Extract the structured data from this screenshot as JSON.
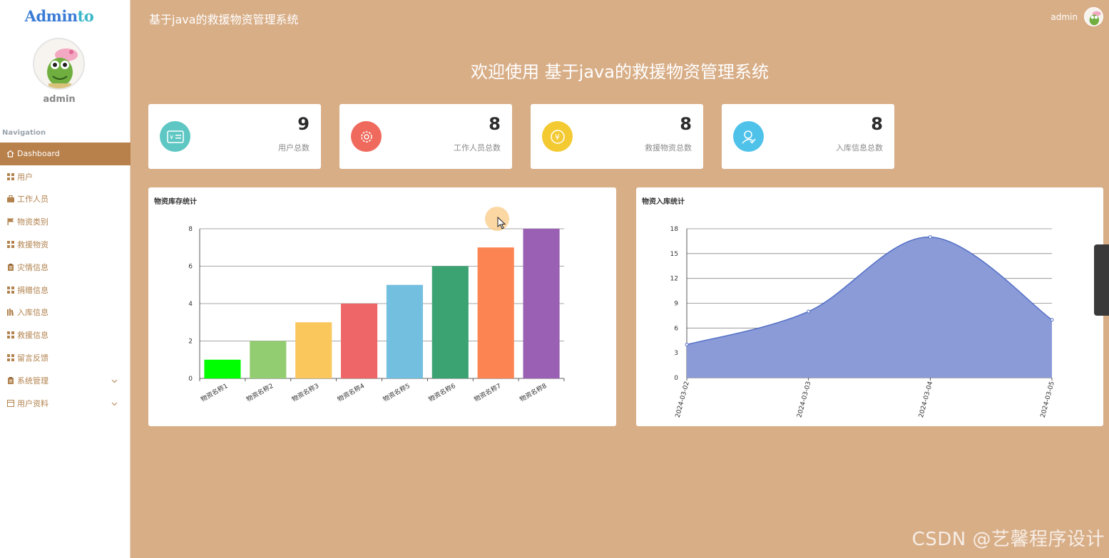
{
  "brand": {
    "logo_part1": "Admin",
    "logo_part2": "to"
  },
  "sidebar": {
    "username": "admin",
    "nav_heading": "Navigation",
    "items": [
      {
        "label": "Dashboard",
        "icon": "home-icon"
      },
      {
        "label": "用户",
        "icon": "grid-icon"
      },
      {
        "label": "工作人员",
        "icon": "briefcase-icon"
      },
      {
        "label": "物资类别",
        "icon": "flag-icon"
      },
      {
        "label": "救援物资",
        "icon": "grid-icon"
      },
      {
        "label": "灾情信息",
        "icon": "clipboard-icon"
      },
      {
        "label": "捐赠信息",
        "icon": "grid-icon"
      },
      {
        "label": "入库信息",
        "icon": "books-icon"
      },
      {
        "label": "救援信息",
        "icon": "grid-icon"
      },
      {
        "label": "留言反馈",
        "icon": "grid-icon"
      },
      {
        "label": "系统管理",
        "icon": "clipboard-icon"
      },
      {
        "label": "用户资料",
        "icon": "form-icon"
      }
    ]
  },
  "topbar": {
    "title": "基于java的救援物资管理系统",
    "user": "admin"
  },
  "welcome": "欢迎使用 基于java的救援物资管理系统",
  "stats": [
    {
      "value": "9",
      "label": "用户总数",
      "icon": "id-card-icon",
      "color": "#5ec7c3"
    },
    {
      "value": "8",
      "label": "工作人员总数",
      "icon": "gear-icon",
      "color": "#ef6a5c"
    },
    {
      "value": "8",
      "label": "救援物资总数",
      "icon": "yen-icon",
      "color": "#f4ca33"
    },
    {
      "value": "8",
      "label": "入库信息总数",
      "icon": "user-check-icon",
      "color": "#4fc2ea"
    }
  ],
  "chart_data": [
    {
      "type": "bar",
      "title": "物资库存统计",
      "categories": [
        "物资名称1",
        "物资名称2",
        "物资名称3",
        "物资名称4",
        "物资名称5",
        "物资名称6",
        "物资名称7",
        "物资名称8"
      ],
      "values": [
        1,
        2,
        3,
        4,
        5,
        6,
        7,
        8
      ],
      "colors": [
        "#00ff00",
        "#93cd72",
        "#f9c75b",
        "#ee6668",
        "#73bfdf",
        "#3ba272",
        "#fc8452",
        "#9a60b4"
      ],
      "ylim": [
        0,
        8
      ],
      "yticks": [
        0,
        2,
        4,
        6,
        8
      ],
      "grid": true
    },
    {
      "type": "area",
      "title": "物资入库统计",
      "x": [
        "2024-03-02",
        "2024-03-03",
        "2024-03-04",
        "2024-03-05"
      ],
      "values": [
        4,
        8,
        17,
        7
      ],
      "color": "#5470c6",
      "ylim": [
        0,
        18
      ],
      "yticks": [
        0,
        3,
        6,
        9,
        12,
        15,
        18
      ],
      "grid": true
    }
  ],
  "watermark": "CSDN @艺馨程序设计"
}
